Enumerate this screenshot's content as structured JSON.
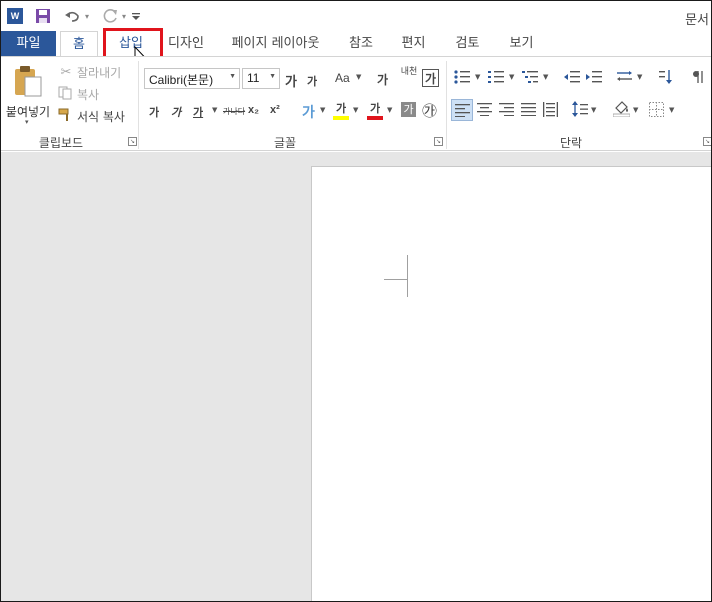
{
  "titlebar": {
    "app_logo": "W",
    "doc_title": "문서",
    "icons": [
      "word-logo",
      "save-icon",
      "undo-icon",
      "redo-icon",
      "customize-qat-icon"
    ]
  },
  "tabs": {
    "file": "파일",
    "home": "홈",
    "insert": "삽입",
    "design": "디자인",
    "layout": "페이지 레이아웃",
    "references": "참조",
    "mailings": "편지",
    "review": "검토",
    "view": "보기"
  },
  "clipboard": {
    "paste": "붙여넣기",
    "cut": "잘라내기",
    "copy": "복사",
    "format_painter": "서식 복사",
    "group_label": "클립보드"
  },
  "font": {
    "font_name": "Calibri(본문)",
    "font_size": "11",
    "grow": "가",
    "shrink": "가",
    "change_case": "Aa",
    "clear_format": "가",
    "phonetic": "내천",
    "char_border": "가",
    "bold": "가",
    "italic": "가",
    "underline": "가",
    "strikethrough": "가나다",
    "subscript": "x₂",
    "superscript": "x²",
    "text_effects": "가",
    "highlight": "가",
    "font_color": "가",
    "char_shading": "가",
    "enclose": "㉮",
    "group_label": "글꼴"
  },
  "paragraph": {
    "group_label": "단락"
  },
  "colors": {
    "accent": "#2b579a",
    "highlight_box": "#e0141c",
    "font_color_bar": "#e0141c",
    "highlight_bar": "#ffff00"
  }
}
